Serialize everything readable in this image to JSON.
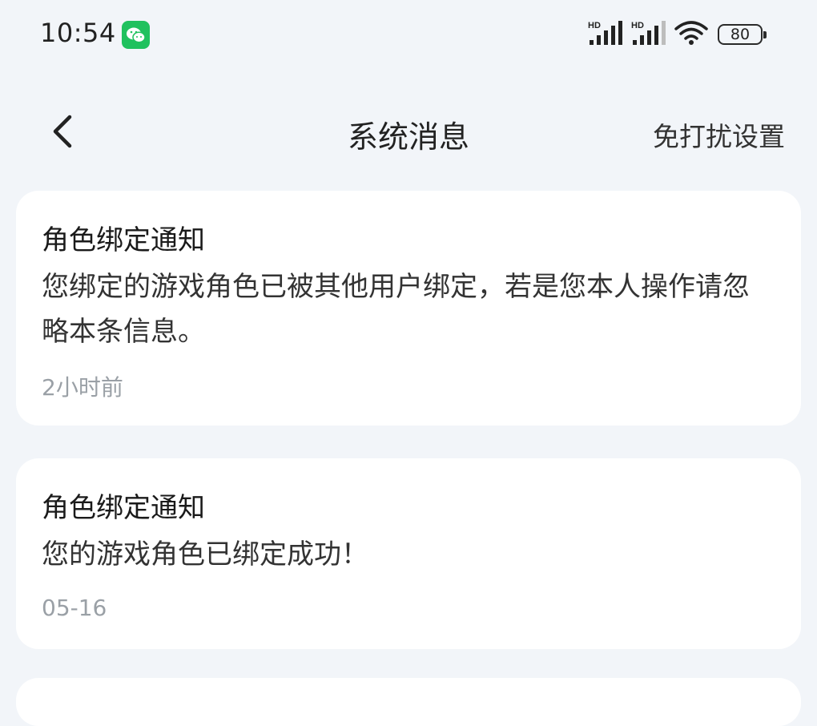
{
  "status_bar": {
    "time": "10:54",
    "battery": "80",
    "icons": [
      "wechat-icon",
      "signal-hd-icon",
      "signal-hd-icon",
      "wifi-icon",
      "battery-icon"
    ],
    "colors": {
      "wechat": "#20c15e"
    }
  },
  "header": {
    "title": "系统消息",
    "back_icon": "chevron-left-icon",
    "dnd_label": "免打扰设置"
  },
  "messages": [
    {
      "title": "角色绑定通知",
      "body": "您绑定的游戏角色已被其他用户绑定，若是您本人操作请忽略本条信息。",
      "time": "2小时前"
    },
    {
      "title": "角色绑定通知",
      "body": "您的游戏角色已绑定成功！",
      "time": "05-16"
    }
  ]
}
